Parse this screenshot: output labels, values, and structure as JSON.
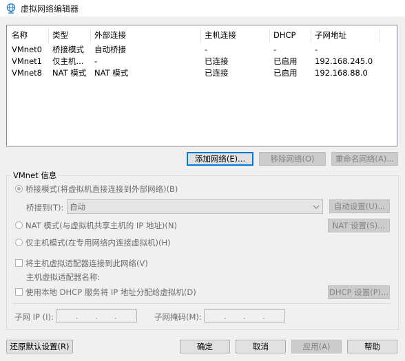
{
  "window": {
    "title": "虚拟网络编辑器",
    "icon": "globe-network-icon"
  },
  "network_list": {
    "columns": [
      "名称",
      "类型",
      "外部连接",
      "主机连接",
      "DHCP",
      "子网地址"
    ],
    "rows": [
      [
        "VMnet0",
        "桥接模式",
        "自动桥接",
        "-",
        "-",
        "-"
      ],
      [
        "VMnet1",
        "仅主机...",
        "-",
        "已连接",
        "已启用",
        "192.168.245.0"
      ],
      [
        "VMnet8",
        "NAT 模式",
        "NAT 模式",
        "已连接",
        "已启用",
        "192.168.88.0"
      ]
    ]
  },
  "list_buttons": {
    "add": "添加网络(E)...",
    "remove": "移除网络(O)",
    "rename": "重命名网络(A)..."
  },
  "vmnet_info": {
    "group_title": "VMnet 信息",
    "bridged_label": "桥接模式(将虚拟机直接连接到外部网络)(B)",
    "bridged_to_label": "桥接到(T):",
    "bridged_to_value": "自动",
    "auto_settings": "自动设置(U)...",
    "nat_label": "NAT 模式(与虚拟机共享主机的 IP 地址)(N)",
    "nat_settings": "NAT 设置(S)...",
    "hostonly_label": "仅主机模式(在专用网络内连接虚拟机)(H)",
    "connect_adapter_label": "将主机虚拟适配器连接到此网络(V)",
    "adapter_name_label": "主机虚拟适配器名称:",
    "dhcp_label": "使用本地 DHCP 服务将 IP 地址分配给虚拟机(D)",
    "dhcp_settings": "DHCP 设置(P)...",
    "subnet_ip_label": "子网 IP (I):",
    "subnet_mask_label": "子网掩码(M):"
  },
  "footer": {
    "restore_defaults": "还原默认设置(R)",
    "ok": "确定",
    "cancel": "取消",
    "apply": "应用(A)",
    "help": "帮助"
  },
  "state": {
    "selected_mode": "bridged",
    "connect_adapter_checked": false,
    "dhcp_checked": false
  }
}
